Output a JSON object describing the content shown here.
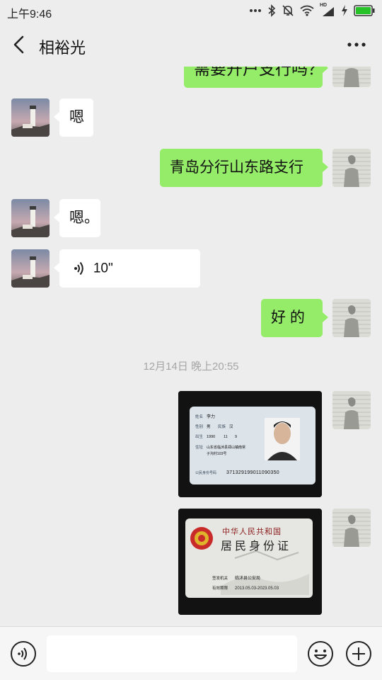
{
  "status_bar": {
    "time": "上午9:46",
    "hd_label": "HD",
    "icons": [
      "dots-icon",
      "bluetooth-icon",
      "mute-icon",
      "wifi-icon",
      "signal-icon",
      "charging-icon",
      "battery-icon"
    ]
  },
  "header": {
    "title": "相裕光",
    "back_icon": "back-chevron-icon",
    "more_icon": "more-dots-icon"
  },
  "messages": [
    {
      "side": "out",
      "type": "text",
      "text": "需要开户支行吗？",
      "partial": true
    },
    {
      "side": "in",
      "type": "text",
      "text": "嗯"
    },
    {
      "side": "out",
      "type": "text",
      "text": "青岛分行山东路支行"
    },
    {
      "side": "in",
      "type": "text",
      "text": "嗯。"
    },
    {
      "side": "in",
      "type": "voice",
      "duration": "10\""
    },
    {
      "side": "out",
      "type": "text",
      "text": "好 的"
    },
    {
      "type": "timestamp",
      "text": "12月14日 晚上20:55"
    },
    {
      "side": "out",
      "type": "image",
      "content": "id-card-front"
    },
    {
      "side": "out",
      "type": "image",
      "content": "id-card-back"
    }
  ],
  "id_card_front": {
    "name_label": "姓名",
    "name": "李力",
    "sex_label": "性别",
    "sex": "男",
    "ethnicity_label": "民族",
    "ethnicity": "汉",
    "birth_label": "出生",
    "birth_year": "1990",
    "birth_month": "11",
    "birth_day": "9",
    "address_label": "住址",
    "address_line1": "山东省临沭县郑山镇南常",
    "address_line2": "子沟村103号",
    "id_label": "公民身份号码",
    "id_number": "371329199011090350"
  },
  "id_card_back": {
    "country": "中华人民共和国",
    "title": "居民身份证",
    "authority_label": "签发机关",
    "authority": "临沭县公安局",
    "validity_label": "有效期限",
    "validity": "2013.05.03-2023.05.03"
  },
  "input_bar": {
    "placeholder": "",
    "value": "",
    "icons": [
      "voice-input-icon",
      "emoji-icon",
      "plus-icon"
    ]
  },
  "colors": {
    "background": "#ededed",
    "outgoing_bubble": "#95ec69",
    "incoming_bubble": "#ffffff",
    "timestamp_text": "#a6a6a6"
  }
}
